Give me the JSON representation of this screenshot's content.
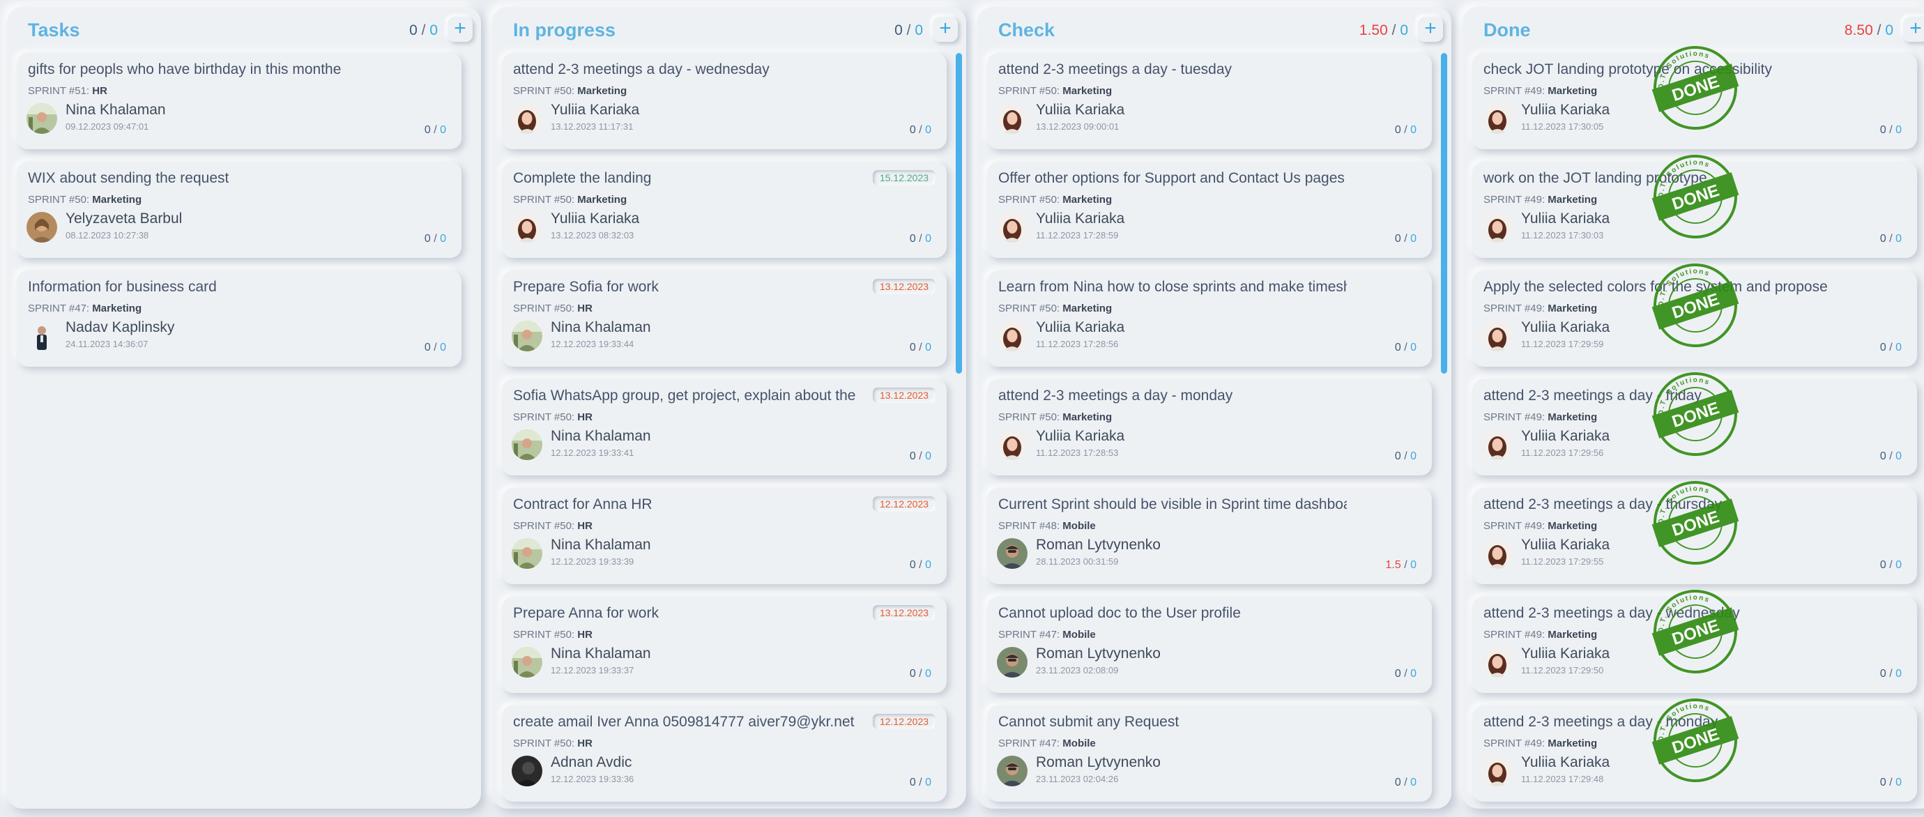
{
  "columns": [
    {
      "title": "Tasks",
      "count": "0",
      "count_total": "0",
      "count_red": false,
      "add_label": "+",
      "cards": [
        {
          "title": "gifts for peopls who have birthday in this monthe",
          "sprint_prefix": "SPRINT #51:",
          "sprint_team": "HR",
          "user": "Nina Khalaman",
          "time": "09.12.2023 09:47:01",
          "hours": "0",
          "hours_total": "0",
          "avatar": "nina"
        },
        {
          "title": "WIX about sending the request",
          "sprint_prefix": "SPRINT #50:",
          "sprint_team": "Marketing",
          "user": "Yelyzaveta Barbul",
          "time": "08.12.2023 10:27:38",
          "hours": "0",
          "hours_total": "0",
          "avatar": "yelyzaveta"
        },
        {
          "title": "Information for business card",
          "sprint_prefix": "SPRINT #47:",
          "sprint_team": "Marketing",
          "user": "Nadav Kaplinsky",
          "time": "24.11.2023 14:36:07",
          "hours": "0",
          "hours_total": "0",
          "avatar": "nadav"
        }
      ]
    },
    {
      "title": "In progress",
      "count": "0",
      "count_total": "0",
      "count_red": false,
      "add_label": "+",
      "cards": [
        {
          "title": "attend 2-3 meetings a day - wednesday",
          "sprint_prefix": "SPRINT #50:",
          "sprint_team": "Marketing",
          "user": "Yuliia Kariaka",
          "time": "13.12.2023 11:17:31",
          "hours": "0",
          "hours_total": "0",
          "avatar": "yuliia"
        },
        {
          "title": "Complete the landing",
          "sprint_prefix": "SPRINT #50:",
          "sprint_team": "Marketing",
          "user": "Yuliia Kariaka",
          "time": "13.12.2023 08:32:03",
          "hours": "0",
          "hours_total": "0",
          "avatar": "yuliia",
          "due": "15.12.2023",
          "due_color": "green"
        },
        {
          "title": "Prepare Sofia for work",
          "sprint_prefix": "SPRINT #50:",
          "sprint_team": "HR",
          "user": "Nina Khalaman",
          "time": "12.12.2023 19:33:44",
          "hours": "0",
          "hours_total": "0",
          "avatar": "nina",
          "due": "13.12.2023",
          "due_color": "red"
        },
        {
          "title": "Sofia WhatsApp group, get project, explain about the",
          "sprint_prefix": "SPRINT #50:",
          "sprint_team": "HR",
          "user": "Nina Khalaman",
          "time": "12.12.2023 19:33:41",
          "hours": "0",
          "hours_total": "0",
          "avatar": "nina",
          "due": "13.12.2023",
          "due_color": "red"
        },
        {
          "title": "Contract for Anna HR",
          "sprint_prefix": "SPRINT #50:",
          "sprint_team": "HR",
          "user": "Nina Khalaman",
          "time": "12.12.2023 19:33:39",
          "hours": "0",
          "hours_total": "0",
          "avatar": "nina",
          "due": "12.12.2023",
          "due_color": "red"
        },
        {
          "title": "Prepare Anna for work",
          "sprint_prefix": "SPRINT #50:",
          "sprint_team": "HR",
          "user": "Nina Khalaman",
          "time": "12.12.2023 19:33:37",
          "hours": "0",
          "hours_total": "0",
          "avatar": "nina",
          "due": "13.12.2023",
          "due_color": "red"
        },
        {
          "title": "create amail Iver Anna 0509814777 aiver79@ykr.net",
          "sprint_prefix": "SPRINT #50:",
          "sprint_team": "HR",
          "user": "Adnan Avdic",
          "time": "12.12.2023 19:33:36",
          "hours": "0",
          "hours_total": "0",
          "avatar": "adnan",
          "due": "12.12.2023",
          "due_color": "red"
        }
      ]
    },
    {
      "title": "Check",
      "count": "1.50",
      "count_total": "0",
      "count_red": true,
      "add_label": "+",
      "cards": [
        {
          "title": "attend 2-3 meetings a day - tuesday",
          "sprint_prefix": "SPRINT #50:",
          "sprint_team": "Marketing",
          "user": "Yuliia Kariaka",
          "time": "13.12.2023 09:00:01",
          "hours": "0",
          "hours_total": "0",
          "avatar": "yuliia"
        },
        {
          "title": "Offer other options for Support and Contact Us pages",
          "sprint_prefix": "SPRINT #50:",
          "sprint_team": "Marketing",
          "user": "Yuliia Kariaka",
          "time": "11.12.2023 17:28:59",
          "hours": "0",
          "hours_total": "0",
          "avatar": "yuliia"
        },
        {
          "title": "Learn from Nina how to close sprints and make timesheet repor",
          "sprint_prefix": "SPRINT #50:",
          "sprint_team": "Marketing",
          "user": "Yuliia Kariaka",
          "time": "11.12.2023 17:28:56",
          "hours": "0",
          "hours_total": "0",
          "avatar": "yuliia"
        },
        {
          "title": "attend 2-3 meetings a day - monday",
          "sprint_prefix": "SPRINT #50:",
          "sprint_team": "Marketing",
          "user": "Yuliia Kariaka",
          "time": "11.12.2023 17:28:53",
          "hours": "0",
          "hours_total": "0",
          "avatar": "yuliia"
        },
        {
          "title": "Current Sprint should be visible in Sprint time dashboard",
          "sprint_prefix": "SPRINT #48:",
          "sprint_team": "Mobile",
          "user": "Roman Lytvynenko",
          "time": "28.11.2023 00:31:59",
          "hours": "1.5",
          "hours_total": "0",
          "hours_red": true,
          "avatar": "roman"
        },
        {
          "title": "Cannot upload doc to the User profile",
          "sprint_prefix": "SPRINT #47:",
          "sprint_team": "Mobile",
          "user": "Roman Lytvynenko",
          "time": "23.11.2023 02:08:09",
          "hours": "0",
          "hours_total": "0",
          "avatar": "roman"
        },
        {
          "title": "Cannot submit any Request",
          "sprint_prefix": "SPRINT #47:",
          "sprint_team": "Mobile",
          "user": "Roman Lytvynenko",
          "time": "23.11.2023 02:04:26",
          "hours": "0",
          "hours_total": "0",
          "avatar": "roman"
        }
      ]
    },
    {
      "title": "Done",
      "count": "8.50",
      "count_total": "0",
      "count_red": true,
      "add_label": "+",
      "stamp_word": "DONE",
      "stamp_ring": "J.O.T. Solutions",
      "cards": [
        {
          "title": "check JOT landing prototype on accessibility",
          "sprint_prefix": "SPRINT #49:",
          "sprint_team": "Marketing",
          "user": "Yuliia Kariaka",
          "time": "11.12.2023 17:30:05",
          "hours": "0",
          "hours_total": "0",
          "avatar": "yuliia"
        },
        {
          "title": "work on the JOT landing prototype",
          "sprint_prefix": "SPRINT #49:",
          "sprint_team": "Marketing",
          "user": "Yuliia Kariaka",
          "time": "11.12.2023 17:30:03",
          "hours": "0",
          "hours_total": "0",
          "avatar": "yuliia"
        },
        {
          "title": "Apply the selected colors for the system and propose for discus",
          "sprint_prefix": "SPRINT #49:",
          "sprint_team": "Marketing",
          "user": "Yuliia Kariaka",
          "time": "11.12.2023 17:29:59",
          "hours": "0",
          "hours_total": "0",
          "avatar": "yuliia"
        },
        {
          "title": "attend 2-3 meetings a day - friday",
          "sprint_prefix": "SPRINT #49:",
          "sprint_team": "Marketing",
          "user": "Yuliia Kariaka",
          "time": "11.12.2023 17:29:56",
          "hours": "0",
          "hours_total": "0",
          "avatar": "yuliia"
        },
        {
          "title": "attend 2-3 meetings a day - thursday",
          "sprint_prefix": "SPRINT #49:",
          "sprint_team": "Marketing",
          "user": "Yuliia Kariaka",
          "time": "11.12.2023 17:29:55",
          "hours": "0",
          "hours_total": "0",
          "avatar": "yuliia"
        },
        {
          "title": "attend 2-3 meetings a day - wednesday",
          "sprint_prefix": "SPRINT #49:",
          "sprint_team": "Marketing",
          "user": "Yuliia Kariaka",
          "time": "11.12.2023 17:29:50",
          "hours": "0",
          "hours_total": "0",
          "avatar": "yuliia"
        },
        {
          "title": "attend 2-3 meetings a day - monday",
          "sprint_prefix": "SPRINT #49:",
          "sprint_team": "Marketing",
          "user": "Yuliia Kariaka",
          "time": "11.12.2023 17:29:48",
          "hours": "0",
          "hours_total": "0",
          "avatar": "yuliia"
        }
      ]
    }
  ],
  "colors": {
    "accent": "#5eb4e2",
    "count_blue": "#3aa8e0",
    "count_red": "#e8413f",
    "due_green": "#4aab88",
    "due_red": "#e65a2a",
    "stamp_green": "#2f8a10",
    "background": "#e9edf2"
  }
}
